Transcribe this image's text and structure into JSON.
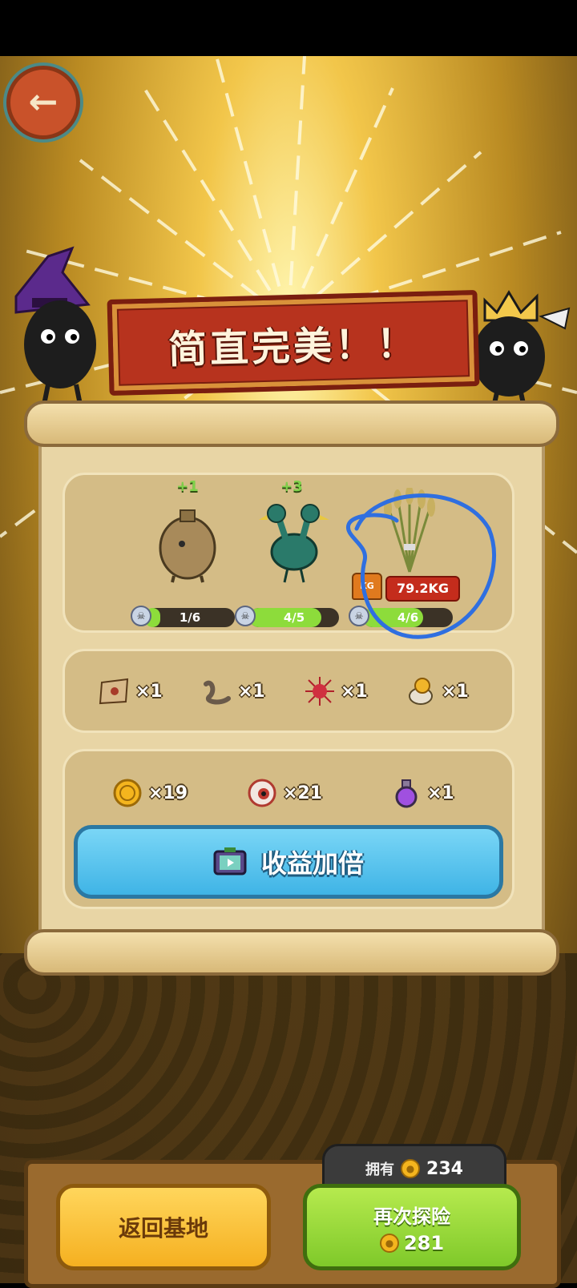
{
  "banner": {
    "title": "简直完美！！"
  },
  "creatures": [
    {
      "bonus": "+1",
      "progress_text": "1/6",
      "progress": 0.167,
      "icon": "sack-creature-icon"
    },
    {
      "bonus": "+3",
      "progress_text": "4/5",
      "progress": 0.8,
      "icon": "two-headed-bird-icon"
    },
    {
      "bonus": "",
      "progress_text": "4/6",
      "progress": 0.667,
      "icon": "wheat-bundle-icon",
      "weight_badge": "KG",
      "weight": "79.2KG"
    }
  ],
  "materials": [
    {
      "icon": "map-scroll-icon",
      "count": "×1"
    },
    {
      "icon": "worm-icon",
      "count": "×1"
    },
    {
      "icon": "red-urchin-icon",
      "count": "×1"
    },
    {
      "icon": "coin-pouch-icon",
      "count": "×1"
    }
  ],
  "rewards": [
    {
      "icon": "gold-coin-icon",
      "count": "×19"
    },
    {
      "icon": "eyeball-icon",
      "count": "×21"
    },
    {
      "icon": "purple-potion-icon",
      "count": "×1"
    }
  ],
  "double_button": {
    "label": "收益加倍",
    "icon": "tv-ad-icon"
  },
  "owned": {
    "label": "拥有",
    "value": "234"
  },
  "return_button": {
    "label": "返回基地"
  },
  "explore_again_button": {
    "label": "再次探险",
    "cost": "281"
  },
  "colors": {
    "banner": "#b7331e",
    "progress": "#8ddc3b",
    "double_button": "#4fbfea",
    "return_button": "#f5b020",
    "explore_button": "#8fd52f"
  }
}
